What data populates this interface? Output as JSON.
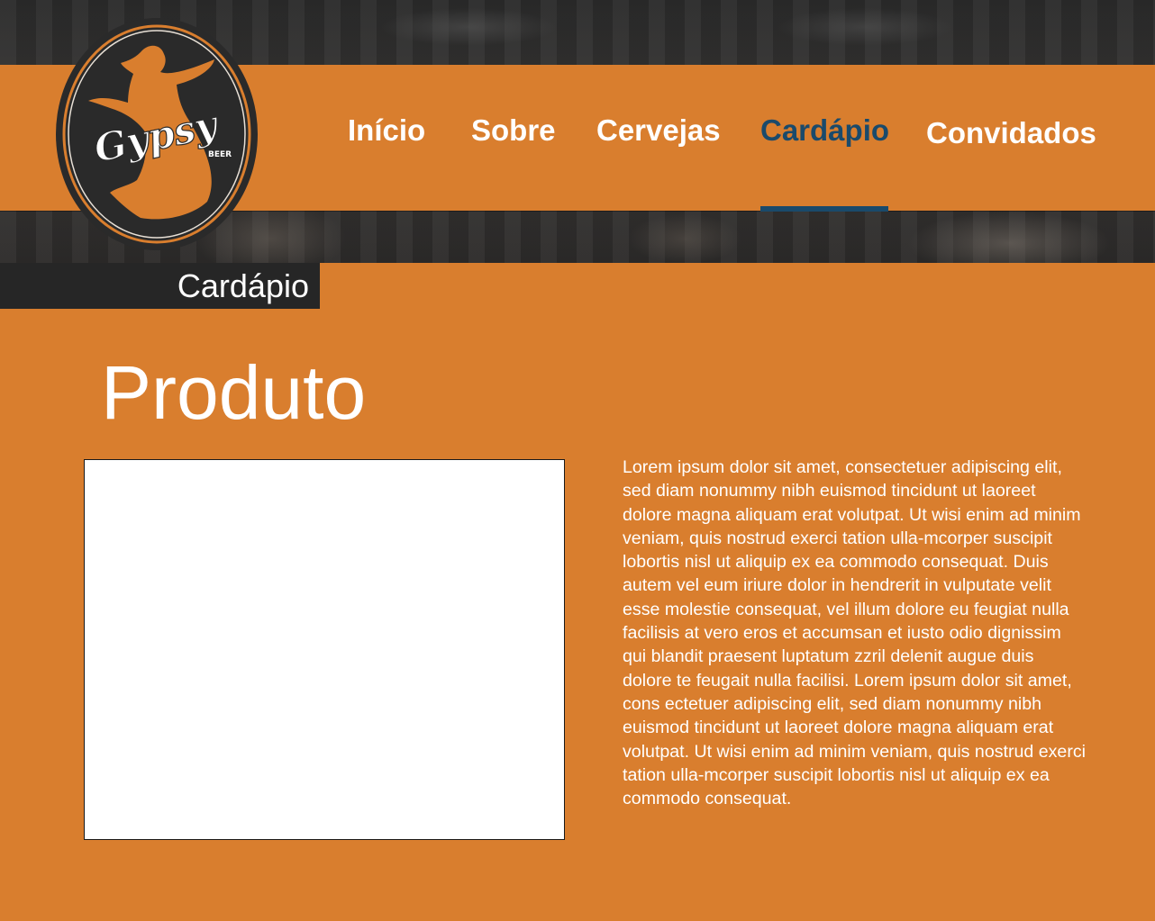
{
  "brand": {
    "logo_text": "Gypsy",
    "logo_subtext": "BEER"
  },
  "nav": {
    "items": [
      {
        "label": "Início"
      },
      {
        "label": "Sobre"
      },
      {
        "label": "Cervejas"
      },
      {
        "label": "Cardápio",
        "active": true
      },
      {
        "label": "Convidados"
      }
    ]
  },
  "section": {
    "title": "Cardápio"
  },
  "product": {
    "title": "Produto",
    "image_placeholder": "",
    "description": "Lorem ipsum dolor sit amet, consectetuer adipiscing elit, sed diam nonummy nibh euismod tincidunt ut laoreet dolore magna aliquam erat volutpat. Ut wisi enim ad minim veniam, quis nostrud exerci tation ulla-mcorper suscipit lobortis nisl ut aliquip ex ea commodo consequat. Duis autem vel eum iriure dolor in hendrerit in vulputate velit esse molestie consequat, vel illum dolore eu feugiat nulla facilisis at vero eros et accumsan et iusto odio dignissim qui blandit praesent luptatum zzril delenit augue duis dolore te feugait nulla facilisi. Lorem ipsum dolor sit amet, cons ectetuer adipiscing elit, sed diam nonummy nibh euismod tincidunt ut laoreet dolore magna aliquam erat volutpat. Ut wisi enim ad minim veniam, quis nostrud exerci tation ulla-mcorper suscipit lobortis nisl ut aliquip ex ea commodo consequat."
  },
  "colors": {
    "background_orange": "#d97e2e",
    "active_nav_blue": "#1a4a6b",
    "dark_tab": "#262626",
    "text_white": "#ffffff"
  },
  "icons": {
    "logo": "dancer-silhouette-logo"
  }
}
